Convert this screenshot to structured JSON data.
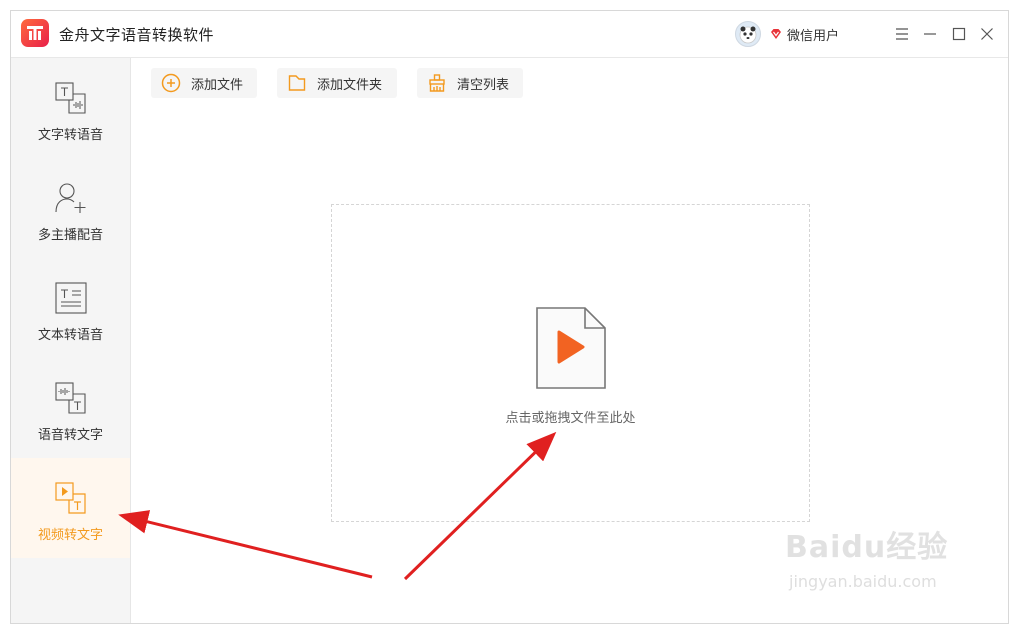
{
  "app": {
    "title": "金舟文字语音转换软件"
  },
  "user": {
    "name": "微信用户"
  },
  "sidebar": {
    "items": [
      {
        "label": "文字转语音",
        "icon": "text-to-speech-icon",
        "active": false
      },
      {
        "label": "多主播配音",
        "icon": "add-user-icon",
        "active": false
      },
      {
        "label": "文本转语音",
        "icon": "document-text-icon",
        "active": false
      },
      {
        "label": "语音转文字",
        "icon": "speech-to-text-icon",
        "active": false
      },
      {
        "label": "视频转文字",
        "icon": "video-to-text-icon",
        "active": true
      }
    ]
  },
  "toolbar": {
    "add_file": "添加文件",
    "add_folder": "添加文件夹",
    "clear_list": "清空列表"
  },
  "dropzone": {
    "hint": "点击或拖拽文件至此处"
  },
  "watermark": {
    "logo": "Baidu经验",
    "url": "jingyan.baidu.com"
  },
  "colors": {
    "accent": "#f39a1e",
    "play": "#f26322",
    "arrow": "#e02020",
    "active_bg": "#fff7ee"
  }
}
